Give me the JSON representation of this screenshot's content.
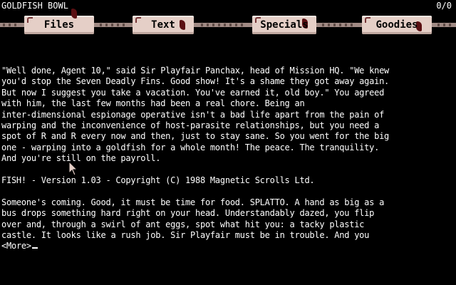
{
  "status": {
    "location": "GOLDFISH BOWL",
    "score": "0/0"
  },
  "menu": {
    "files": "Files",
    "text": "Text",
    "specials": "Specials",
    "goodies": "Goodies"
  },
  "colors": {
    "tab_face": "#e5cfc7",
    "rope": "#a08a84",
    "fin": "#5a0f12",
    "background": "#000000",
    "text": "#ffffff"
  },
  "story": {
    "intro_lines": [
      "\"Well done, Agent 10,\" said Sir Playfair Panchax, head of Mission HQ. \"We knew",
      "you'd stop the Seven Deadly Fins. Good show! It's a shame they got away again.",
      "But now I suggest you take a vacation. You've earned it, old boy.\" You agreed",
      "with him, the last few months had been a real chore. Being an",
      "inter-dimensional espionage operative isn't a bad life apart from the pain of",
      "warping and the inconvenience of host-parasite relationships, but you need a",
      "spot of R and R every now and then, just to stay sane. So you went for the big",
      "one - warping into a goldfish for a whole month! The peace. The tranquility.",
      "And you're still on the payroll."
    ],
    "version_line": "FISH! - Version 1.03 - Copyright (C) 1988 Magnetic Scrolls Ltd.",
    "scene_lines": [
      "Someone's coming. Good, it must be time for food. SPLATTO. A hand as big as a",
      "bus drops something hard right on your head. Understandably dazed, you flip",
      "over and, through a swirl of ant eggs, spot what hit you: a tacky plastic",
      "castle. It looks like a rush job. Sir Playfair must be in trouble. And you"
    ],
    "prompt": "<More>"
  }
}
